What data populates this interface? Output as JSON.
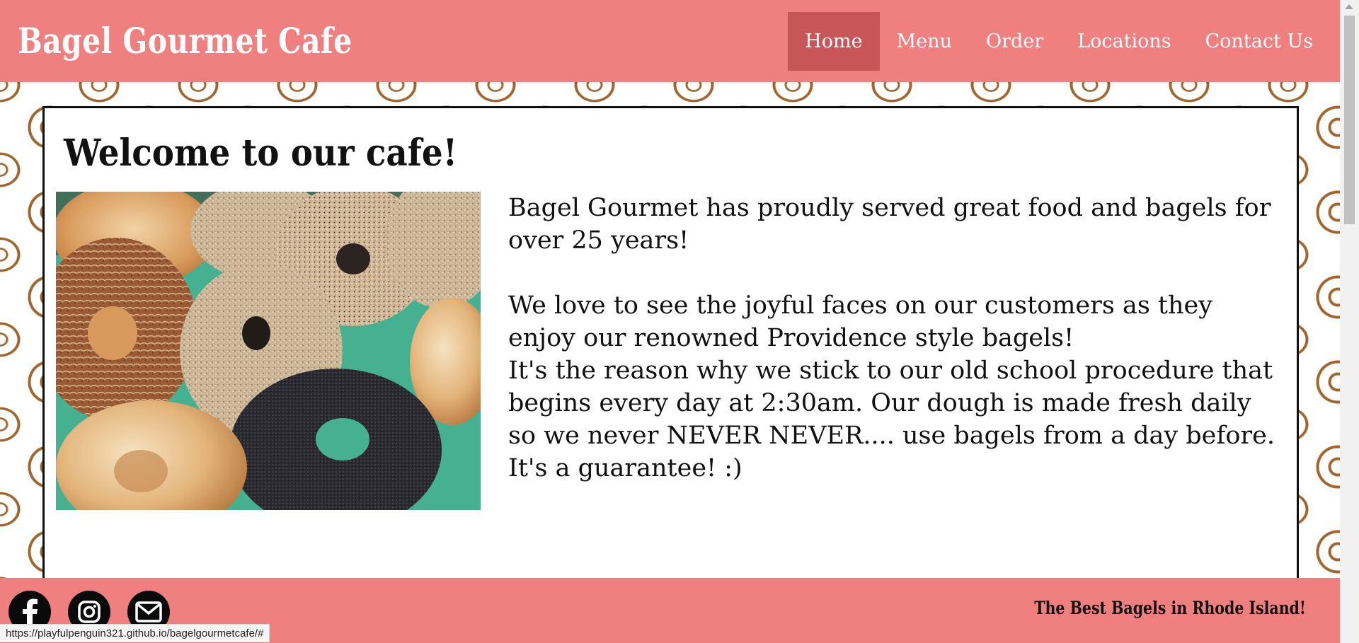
{
  "header": {
    "brand": "Bagel Gourmet Cafe",
    "nav": [
      {
        "label": "Home",
        "active": true
      },
      {
        "label": "Menu",
        "active": false
      },
      {
        "label": "Order",
        "active": false
      },
      {
        "label": "Locations",
        "active": false
      },
      {
        "label": "Contact Us",
        "active": false
      }
    ]
  },
  "main": {
    "heading": "Welcome to our cafe!",
    "photo_alt": "assorted bagels",
    "paragraph1": "Bagel Gourmet has proudly served great food and bagels for over 25 years!",
    "paragraph2": "We love to see the joyful faces on our customers as they enjoy our renowned Providence style bagels!",
    "paragraph3": "It's the reason why we stick to our old school procedure that begins every day at 2:30am. Our dough is made fresh daily so we never NEVER NEVER.... use bagels from a day before. It's a guarantee! :)"
  },
  "footer": {
    "social_icons": [
      "facebook-icon",
      "instagram-icon",
      "mail-icon"
    ],
    "tagline": "The Best Bagels in Rhode Island!"
  },
  "status_bar": {
    "url": "https://playfulpenguin321.github.io/bagelgourmetcafe/#"
  },
  "colors": {
    "header_bg": "#f07f7f",
    "active_nav_bg": "#c85659",
    "pattern": "#a0652e"
  }
}
